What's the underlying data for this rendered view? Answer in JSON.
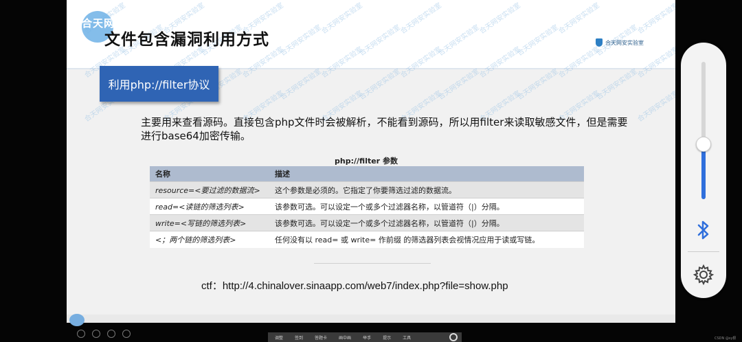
{
  "slide": {
    "logo_text": "合天网",
    "title": "文件包含漏洞利用方式",
    "brand": "合天网安实验室",
    "topic": "利用php://filter协议",
    "description": "主要用来查看源码。直接包含php文件时会被解析，不能看到源码，所以用filter来读取敏感文件，但是需要进行base64加密传输。",
    "table": {
      "caption": "php://filter 参数",
      "headers": [
        "名称",
        "描述"
      ],
      "rows": [
        {
          "name": "resource=<要过滤的数据流>",
          "desc": "这个参数是必须的。它指定了你要筛选过滤的数据流。"
        },
        {
          "name": "read=<读链的筛选列表>",
          "desc": "该参数可选。可以设定一个或多个过滤器名称，以管道符（|）分隔。"
        },
        {
          "name": "write=<写链的筛选列表>",
          "desc": "该参数可选。可以设定一个或多个过滤器名称，以管道符（|）分隔。"
        },
        {
          "name": "<；两个链的筛选列表>",
          "desc": "任何没有以 read= 或 write= 作前缀 的筛选器列表会视情况应用于读或写链。"
        }
      ]
    },
    "ctf": "ctf：http://4.chinalover.sinaapp.com/web7/index.php?file=show.php",
    "watermark": "合天网安实验室"
  },
  "toolbar": {
    "items": [
      "调整",
      "签到",
      "答题卡",
      "画中画",
      "举手",
      "提示",
      "工具"
    ]
  },
  "corner_watermark": "CSDN @sy狠",
  "volume": {
    "level": 0.4,
    "fill_color": "#2f6fdc"
  },
  "icons": {
    "bluetooth": "bluetooth-icon",
    "settings": "gear-icon",
    "power": "power-icon"
  }
}
